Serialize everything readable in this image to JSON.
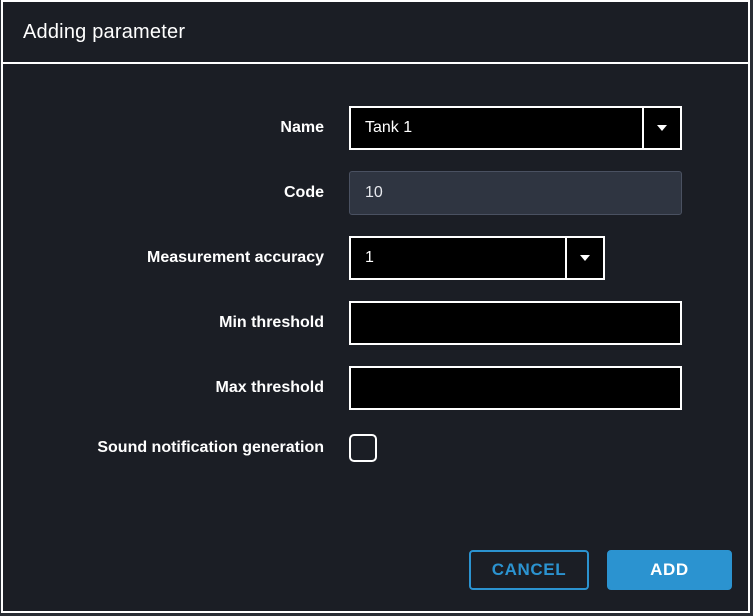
{
  "dialog": {
    "title": "Adding parameter",
    "accent_color": "#2b93d0",
    "background_color": "#1b1e25",
    "border_color": "#ffffff"
  },
  "form": {
    "fields": [
      {
        "label": "Name",
        "type": "combobox",
        "value": "Tank 1",
        "placeholder": "",
        "icon": "chevron-down-icon"
      },
      {
        "label": "Code",
        "type": "readonly-input",
        "value": "10",
        "placeholder": ""
      },
      {
        "label": "Measurement accuracy",
        "type": "combobox",
        "value": "1",
        "placeholder": "",
        "icon": "chevron-down-icon"
      },
      {
        "label": "Min threshold",
        "type": "text-input",
        "value": "",
        "placeholder": ""
      },
      {
        "label": "Max threshold",
        "type": "text-input",
        "value": "",
        "placeholder": ""
      },
      {
        "label": "Sound notification generation",
        "type": "checkbox",
        "checked": false
      }
    ]
  },
  "footer": {
    "cancel_label": "CANCEL",
    "add_label": "ADD"
  }
}
